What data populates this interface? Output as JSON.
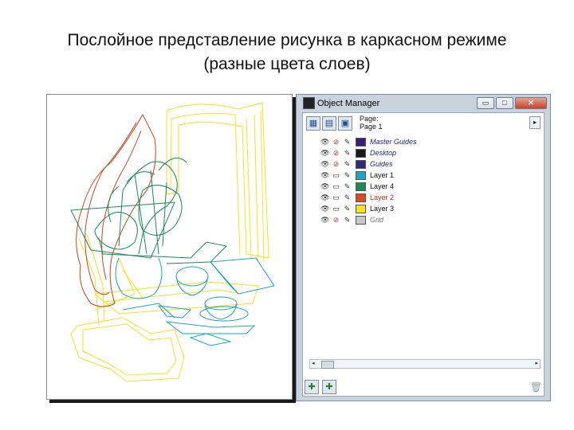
{
  "slide": {
    "title_line1": "Послойное представление рисунка в каркасном режиме",
    "title_line2": "(разные цвета слоев)"
  },
  "object_manager": {
    "title": "Object Manager",
    "window_buttons": {
      "minimize": "▭",
      "maximize": "□",
      "close": "✕"
    },
    "page_label_1": "Page:",
    "page_label_2": "Page 1",
    "expand_label": "▸",
    "layers": [
      {
        "name": "Master Guides",
        "color": "#3a1f7a",
        "style": "master"
      },
      {
        "name": "Desktop",
        "color": "#1a1a1a",
        "style": "master"
      },
      {
        "name": "Guides",
        "color": "#2d2a7e",
        "style": "master"
      },
      {
        "name": "Layer 1",
        "color": "#1aa6c8",
        "style": "plain"
      },
      {
        "name": "Layer 4",
        "color": "#1a8a57",
        "style": "plain"
      },
      {
        "name": "Layer 2",
        "color": "#e14a1e",
        "style": "active"
      },
      {
        "name": "Layer 3",
        "color": "#f6e21a",
        "style": "plain"
      },
      {
        "name": "Grid",
        "color": "#c8c8c8",
        "style": "grid"
      }
    ],
    "scroll_left": "◂",
    "scroll_right": "▸"
  },
  "wireframe_colors": {
    "orange": "#c1461f",
    "yellow": "#f1e321",
    "green": "#1a8a57",
    "cyan": "#1aa6b8"
  }
}
